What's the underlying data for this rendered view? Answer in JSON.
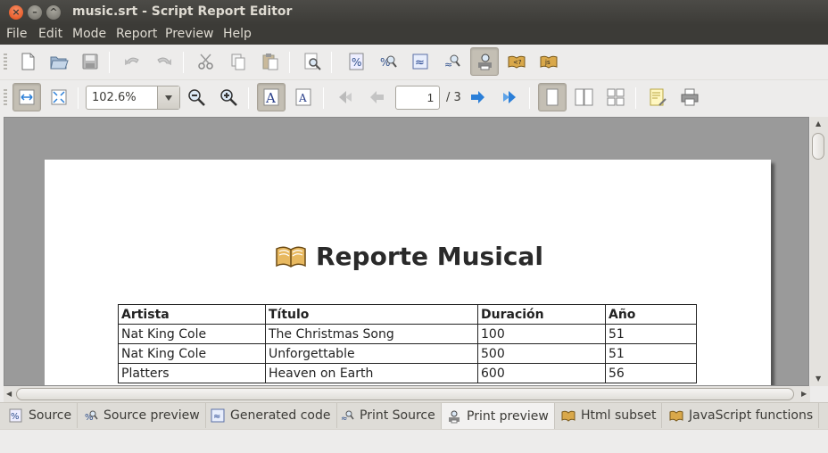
{
  "window": {
    "title": "music.srt - Script Report Editor"
  },
  "menu": [
    "File",
    "Edit",
    "Mode",
    "Report",
    "Preview",
    "Help"
  ],
  "toolbar2": {
    "zoom": "102.6%",
    "page_current": "1",
    "page_total": "/ 3"
  },
  "report": {
    "title": "Reporte Musical",
    "columns": [
      "Artista",
      "Título",
      "Duración",
      "Año"
    ],
    "rows": [
      [
        "Nat King Cole",
        "The Christmas Song",
        "100",
        "51"
      ],
      [
        "Nat King Cole",
        "Unforgettable",
        "500",
        "51"
      ],
      [
        "Platters",
        "Heaven on Earth",
        "600",
        "56"
      ]
    ]
  },
  "tabs": [
    {
      "label": "Source",
      "icon": "source-icon"
    },
    {
      "label": "Source preview",
      "icon": "source-preview-icon"
    },
    {
      "label": "Generated code",
      "icon": "generated-code-icon"
    },
    {
      "label": "Print Source",
      "icon": "print-source-icon"
    },
    {
      "label": "Print preview",
      "icon": "print-preview-icon",
      "active": true
    },
    {
      "label": "Html subset",
      "icon": "html-subset-icon"
    },
    {
      "label": "JavaScript functions",
      "icon": "javascript-functions-icon"
    }
  ],
  "colors": {
    "titlebar": "#3c3b37",
    "close_button": "#df4a16",
    "accent_blue": "#2b7fd8"
  }
}
